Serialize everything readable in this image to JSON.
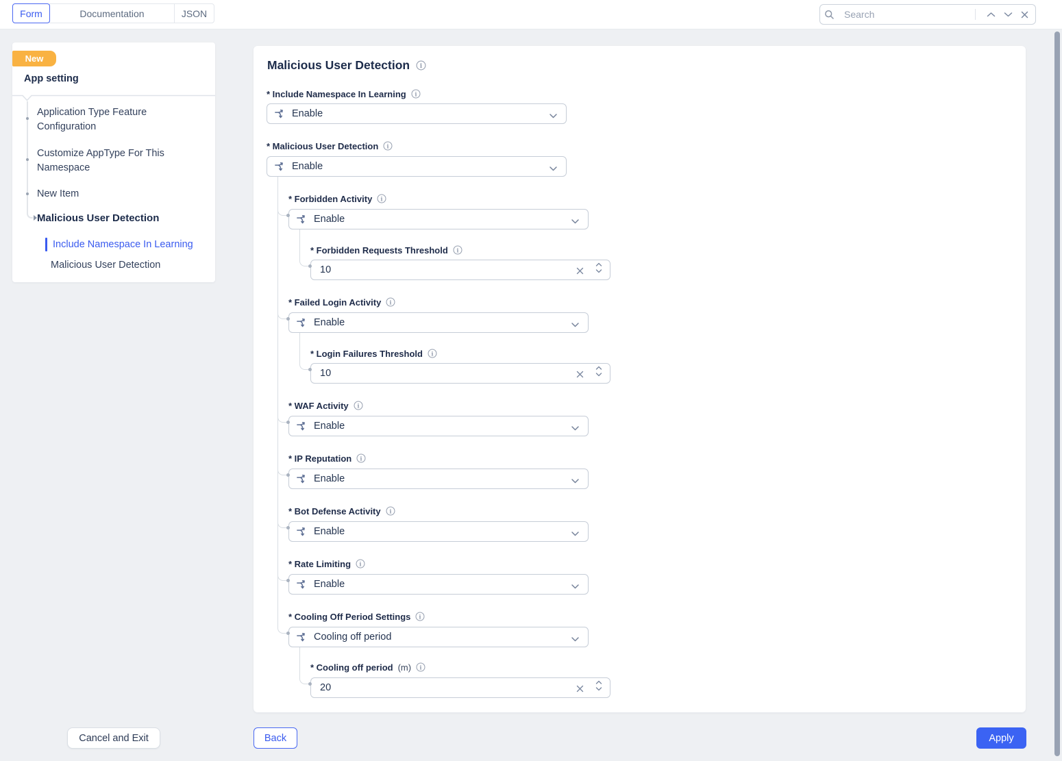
{
  "topbar": {
    "tabs": [
      {
        "label": "Form",
        "active": true
      },
      {
        "label": "Documentation",
        "active": false
      },
      {
        "label": "JSON",
        "active": false
      }
    ],
    "search": {
      "placeholder": "Search"
    }
  },
  "sidebar": {
    "badge": "New",
    "heading": "App setting",
    "items": [
      {
        "label": "Application Type Feature Configuration"
      },
      {
        "label": "Customize AppType For This Namespace"
      },
      {
        "label": "New Item"
      }
    ],
    "section": {
      "label": "Malicious User Detection",
      "subitems": [
        {
          "label": "Include Namespace In Learning",
          "active": true
        },
        {
          "label": "Malicious User Detection",
          "active": false
        }
      ]
    }
  },
  "form": {
    "title": "Malicious User Detection",
    "fields": [
      {
        "label": "* Include Namespace In Learning",
        "type": "select",
        "value": "Enable",
        "level": 0
      },
      {
        "label": "* Malicious User Detection",
        "type": "select",
        "value": "Enable",
        "level": 0
      },
      {
        "label": "* Forbidden Activity",
        "type": "select",
        "value": "Enable",
        "level": 1
      },
      {
        "label": "* Forbidden Requests Threshold",
        "type": "number",
        "value": "10",
        "level": 2
      },
      {
        "label": "* Failed Login Activity",
        "type": "select",
        "value": "Enable",
        "level": 1
      },
      {
        "label": "* Login Failures Threshold",
        "type": "number",
        "value": "10",
        "level": 2
      },
      {
        "label": "* WAF Activity",
        "type": "select",
        "value": "Enable",
        "level": 1
      },
      {
        "label": "* IP Reputation",
        "type": "select",
        "value": "Enable",
        "level": 1
      },
      {
        "label": "* Bot Defense Activity",
        "type": "select",
        "value": "Enable",
        "level": 1
      },
      {
        "label": "* Rate Limiting",
        "type": "select",
        "value": "Enable",
        "level": 1
      },
      {
        "label": "* Cooling Off Period Settings",
        "type": "select",
        "value": "Cooling off period",
        "level": 1
      },
      {
        "label": "* Cooling off period",
        "suffix": "(m)",
        "type": "number",
        "value": "20",
        "level": 2
      }
    ]
  },
  "footer": {
    "cancel": "Cancel and Exit",
    "back": "Back",
    "apply": "Apply"
  },
  "colors": {
    "accent_blue": "#3b63f3",
    "badge_orange": "#f9b242",
    "label_navy": "#1e2b49",
    "border_gray": "#c6cdd7",
    "connector_gray": "#d8dde3"
  }
}
